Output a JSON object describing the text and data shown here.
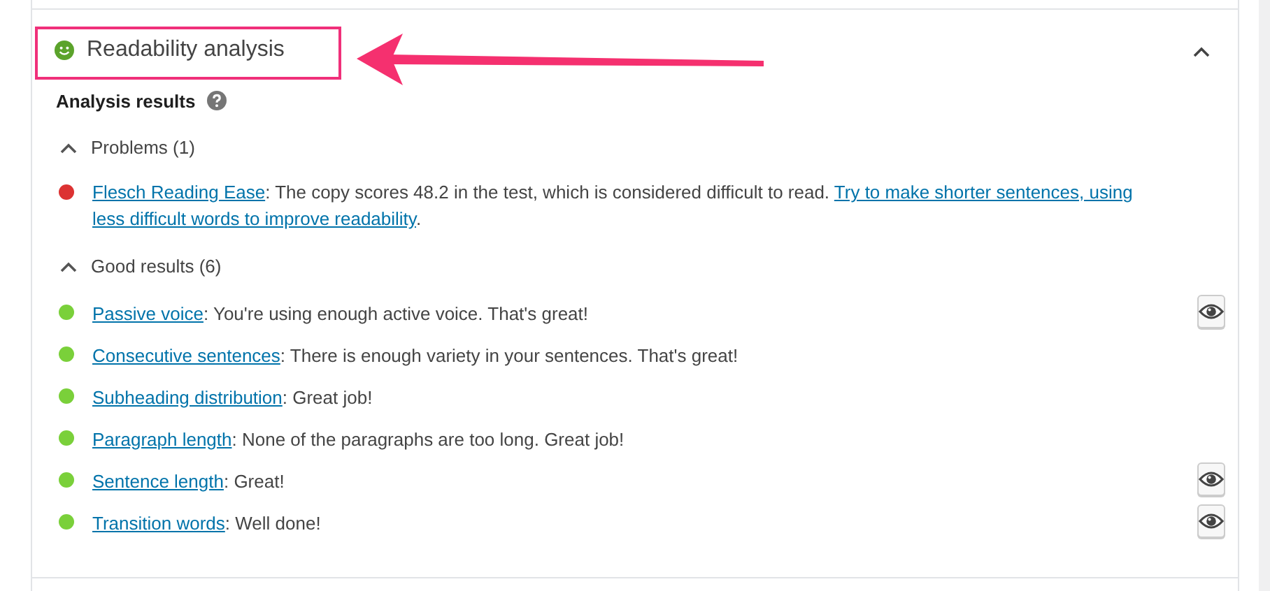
{
  "panel": {
    "title": "Readability analysis",
    "expanded": true,
    "heading": "Analysis results",
    "sections": [
      {
        "label": "Problems (1)",
        "expanded": true,
        "items": [
          {
            "color": "#dc3232",
            "eye_button": false,
            "parts": [
              {
                "kind": "link",
                "text": "Flesch Reading Ease"
              },
              {
                "kind": "text",
                "text": ": The copy scores 48.2 in the test, which is considered difficult to read. "
              },
              {
                "kind": "link",
                "text": "Try to make shorter sentences, using"
              },
              {
                "kind": "link",
                "text": "less difficult words to improve readability"
              },
              {
                "kind": "text",
                "text": "."
              }
            ]
          }
        ]
      },
      {
        "label": "Good results (6)",
        "expanded": true,
        "items": [
          {
            "color": "#7ad03a",
            "eye_button": true,
            "parts": [
              {
                "kind": "link",
                "text": "Passive voice"
              },
              {
                "kind": "text",
                "text": ": You're using enough active voice. That's great!"
              }
            ]
          },
          {
            "color": "#7ad03a",
            "eye_button": false,
            "parts": [
              {
                "kind": "link",
                "text": "Consecutive sentences"
              },
              {
                "kind": "text",
                "text": ": There is enough variety in your sentences. That's great!"
              }
            ]
          },
          {
            "color": "#7ad03a",
            "eye_button": false,
            "parts": [
              {
                "kind": "link",
                "text": "Subheading distribution"
              },
              {
                "kind": "text",
                "text": ": Great job!"
              }
            ]
          },
          {
            "color": "#7ad03a",
            "eye_button": false,
            "parts": [
              {
                "kind": "link",
                "text": "Paragraph length"
              },
              {
                "kind": "text",
                "text": ": None of the paragraphs are too long. Great job!"
              }
            ]
          },
          {
            "color": "#7ad03a",
            "eye_button": true,
            "parts": [
              {
                "kind": "link",
                "text": "Sentence length"
              },
              {
                "kind": "text",
                "text": ": Great!"
              }
            ]
          },
          {
            "color": "#7ad03a",
            "eye_button": true,
            "parts": [
              {
                "kind": "link",
                "text": "Transition words"
              },
              {
                "kind": "text",
                "text": ": Well done!"
              }
            ]
          }
        ]
      }
    ]
  }
}
